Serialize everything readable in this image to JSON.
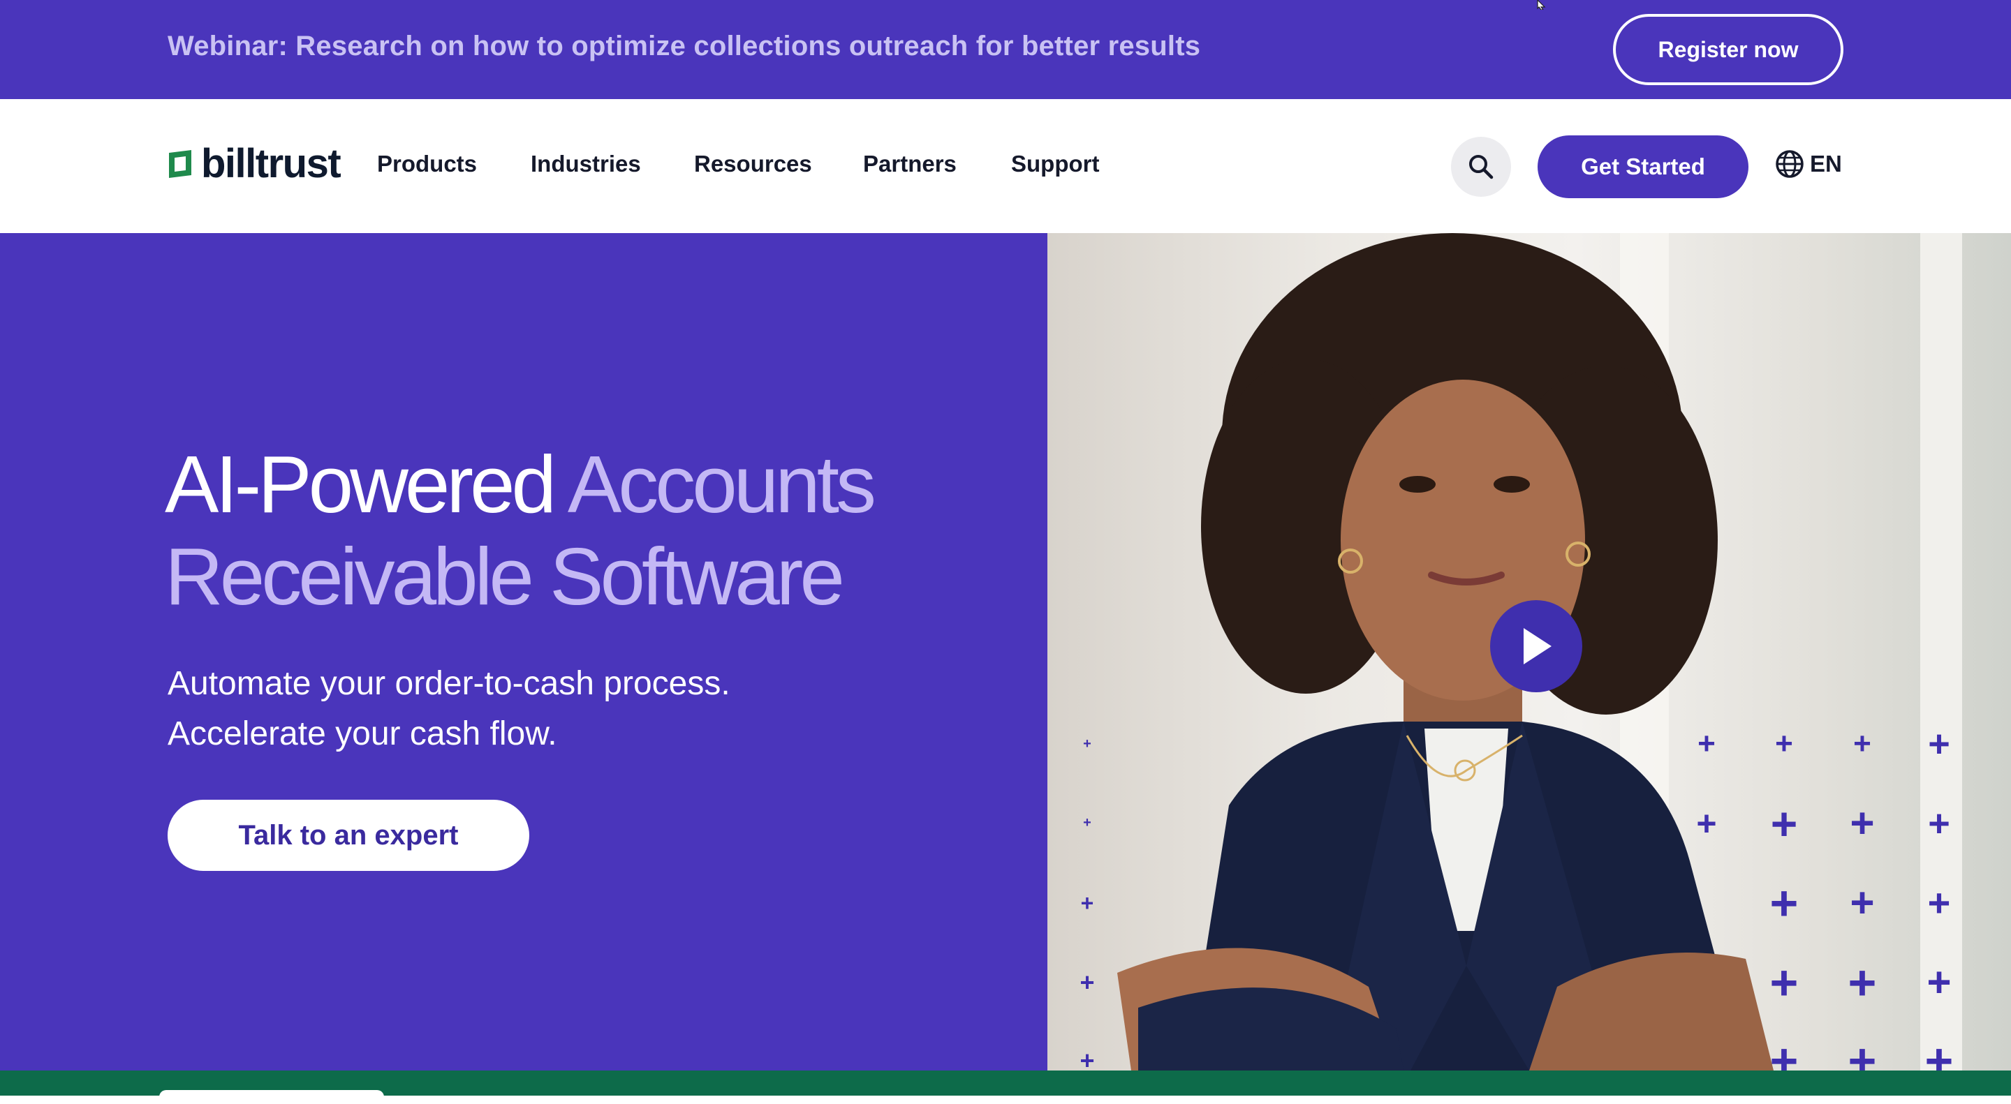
{
  "announcement": {
    "text": "Webinar: Research on how to optimize collections outreach for better results",
    "cta_label": "Register now"
  },
  "brand": {
    "logo_text": "billtrust",
    "primary_color": "#4a35bb",
    "accent_text_color": "#c4b8f5",
    "footer_green": "#0d6b4a"
  },
  "nav": {
    "items": [
      {
        "label": "Products"
      },
      {
        "label": "Industries"
      },
      {
        "label": "Resources"
      },
      {
        "label": "Partners"
      },
      {
        "label": "Support"
      }
    ],
    "search_icon": "search-icon",
    "cta_label": "Get Started",
    "language_icon": "globe-icon",
    "language_label": "EN"
  },
  "hero": {
    "title_part1": "AI-Powered",
    "title_part2": "Accounts",
    "title_part3": "Receivable Software",
    "subtitle_line1": "Automate your order-to-cash process.",
    "subtitle_line2": "Accelerate your cash flow.",
    "cta_label": "Talk to an expert",
    "video_icon": "play-icon"
  }
}
